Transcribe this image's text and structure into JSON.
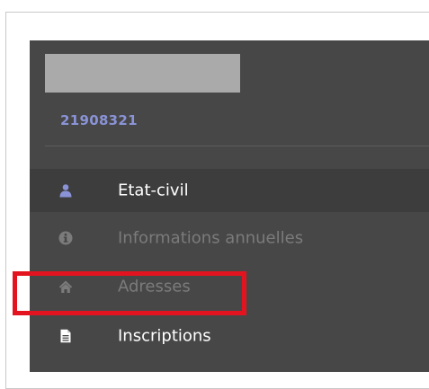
{
  "student": {
    "id": "21908321"
  },
  "menu": {
    "items": [
      {
        "key": "etat-civil",
        "label": "Etat-civil",
        "icon": "user-icon",
        "active": true
      },
      {
        "key": "informations-annuelles",
        "label": "Informations annuelles",
        "icon": "info-icon",
        "active": false
      },
      {
        "key": "adresses",
        "label": "Adresses",
        "icon": "home-icon",
        "active": false
      },
      {
        "key": "inscriptions",
        "label": "Inscriptions",
        "icon": "document-icon",
        "active": false,
        "highlighted": true
      }
    ]
  },
  "colors": {
    "panel_bg": "#474747",
    "active_bg": "#3d3d3d",
    "id_text": "#8a93d6",
    "user_icon": "#8a93d6",
    "dim_text": "#7b7b7b",
    "highlight_border": "#e3141f"
  }
}
